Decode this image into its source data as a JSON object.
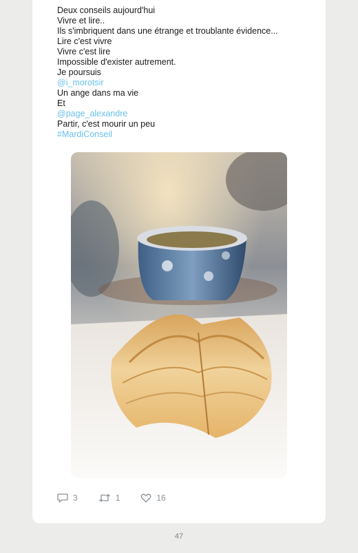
{
  "tweet": {
    "lines": [
      {
        "text": "Deux conseils aujourd'hui",
        "type": "text"
      },
      {
        "text": "Vivre et lire..",
        "type": "text"
      },
      {
        "text": "Ils s'imbriquent dans une étrange et troublante évidence...",
        "type": "text"
      },
      {
        "text": "Lire c'est vivre",
        "type": "text"
      },
      {
        "text": "Vivre c'est lire",
        "type": "text"
      },
      {
        "text": "Impossible d'exister autrement.",
        "type": "text"
      },
      {
        "text": "Je poursuis",
        "type": "text"
      },
      {
        "text": "@i_morotsir",
        "type": "mention"
      },
      {
        "text": "Un ange dans ma vie",
        "type": "text"
      },
      {
        "text": "Et",
        "type": "text"
      },
      {
        "text": "@page_alexandre",
        "type": "mention"
      },
      {
        "text": "Partir, c'est mourir un peu",
        "type": "text"
      },
      {
        "text": "#MardiConseil",
        "type": "hashtag"
      }
    ],
    "link_color": "#6cc0ea"
  },
  "actions": {
    "reply_count": "3",
    "retweet_count": "1",
    "like_count": "16",
    "reply_icon": "comment-icon",
    "retweet_icon": "retweet-icon",
    "like_icon": "heart-icon"
  },
  "page": {
    "number": "47"
  }
}
